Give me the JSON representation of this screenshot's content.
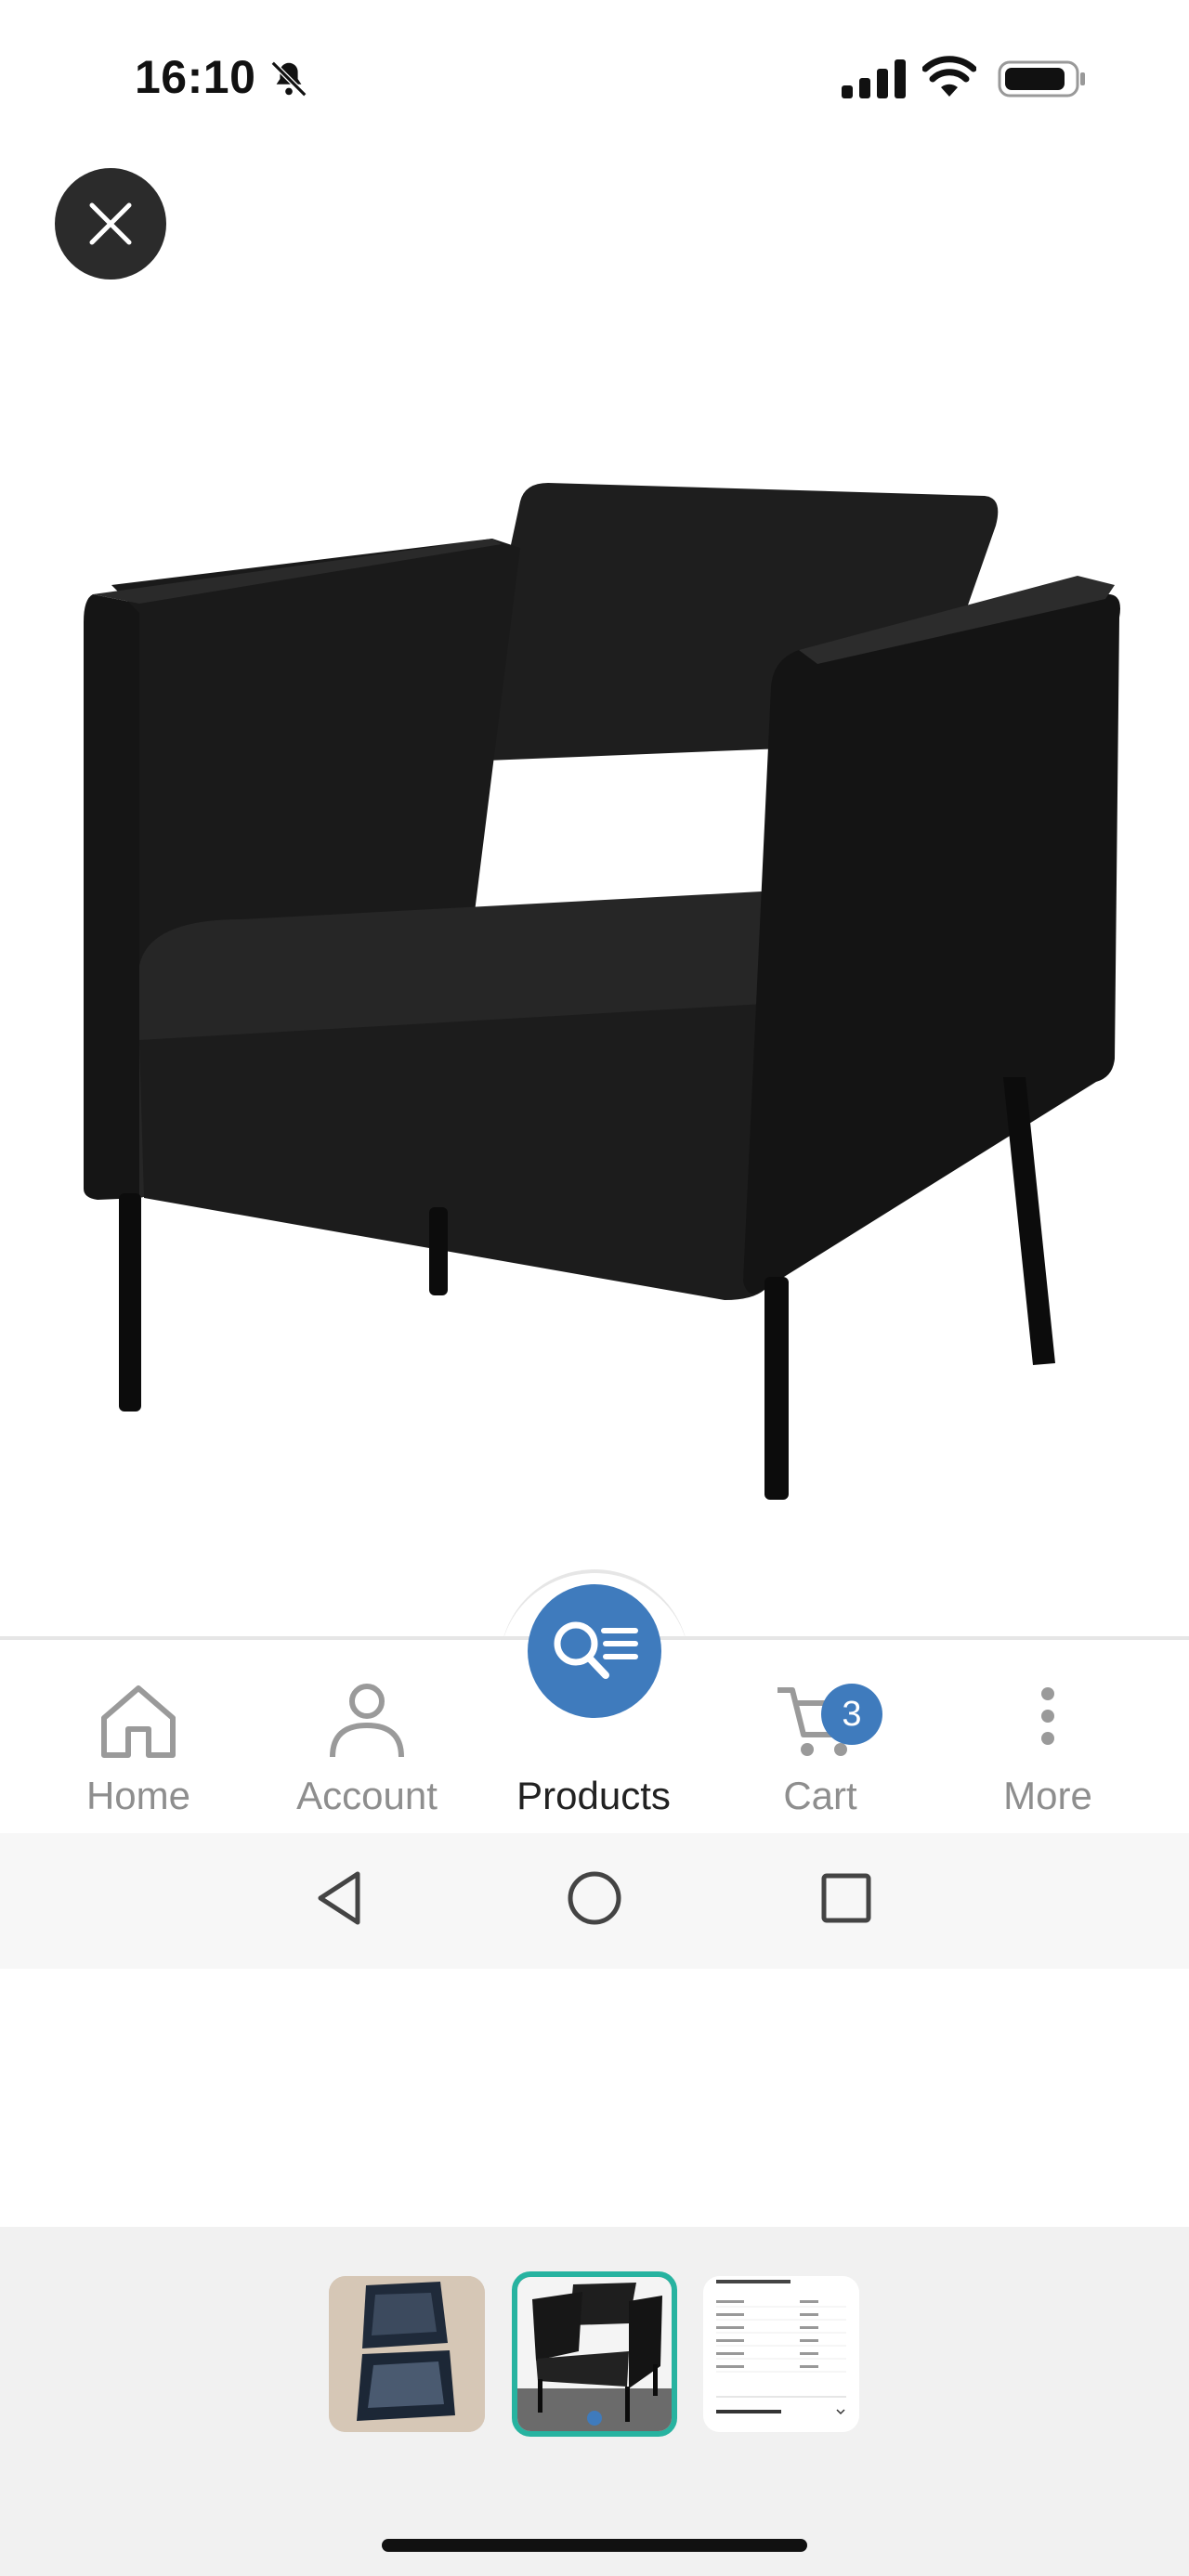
{
  "status_bar": {
    "time": "16:10"
  },
  "bottom_nav": {
    "items": [
      {
        "label": "Home",
        "icon": "home-icon"
      },
      {
        "label": "Account",
        "icon": "user-icon"
      },
      {
        "label": "Products",
        "icon": "product-search-icon",
        "active": true
      },
      {
        "label": "Cart",
        "icon": "cart-icon",
        "badge": "3"
      },
      {
        "label": "More",
        "icon": "more-vertical-icon"
      }
    ]
  },
  "colors": {
    "accent": "#3f7bbd",
    "selected_border": "#27b3a0",
    "close_bg": "#2b2b2b"
  },
  "thumbnails": {
    "count": 3,
    "selected_index": 1
  }
}
